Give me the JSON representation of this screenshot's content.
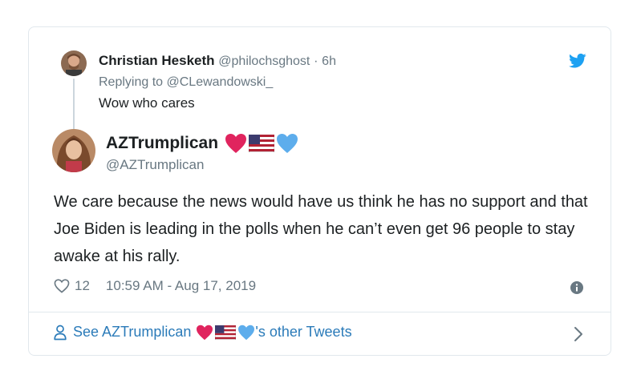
{
  "parent_tweet": {
    "author_name": "Christian Hesketh",
    "author_handle": "@philochsghost",
    "separator": "·",
    "time_ago": "6h",
    "replying_to_prefix": "Replying to",
    "replying_to_handle": "@CLewandowski_",
    "text": "Wow who cares"
  },
  "main_tweet": {
    "author_name": "AZTrumplican",
    "author_handle": "@AZTrumplican",
    "name_emojis": [
      "red-heart",
      "us-flag",
      "blue-heart"
    ],
    "text": "We care because the news would have us think he has no support and that Joe Biden is leading in the polls when he can’t even get 96 people to stay awake at his rally.",
    "like_count": "12",
    "timestamp": "10:59 AM - Aug 17, 2019"
  },
  "footer": {
    "prefix": "See AZTrumplican",
    "suffix": "'s other Tweets"
  },
  "colors": {
    "twitter_blue": "#1da1f2",
    "link_blue": "#2b7bb9",
    "muted_text": "#697882",
    "red_heart": "#e0245e",
    "blue_heart": "#5dadec"
  }
}
